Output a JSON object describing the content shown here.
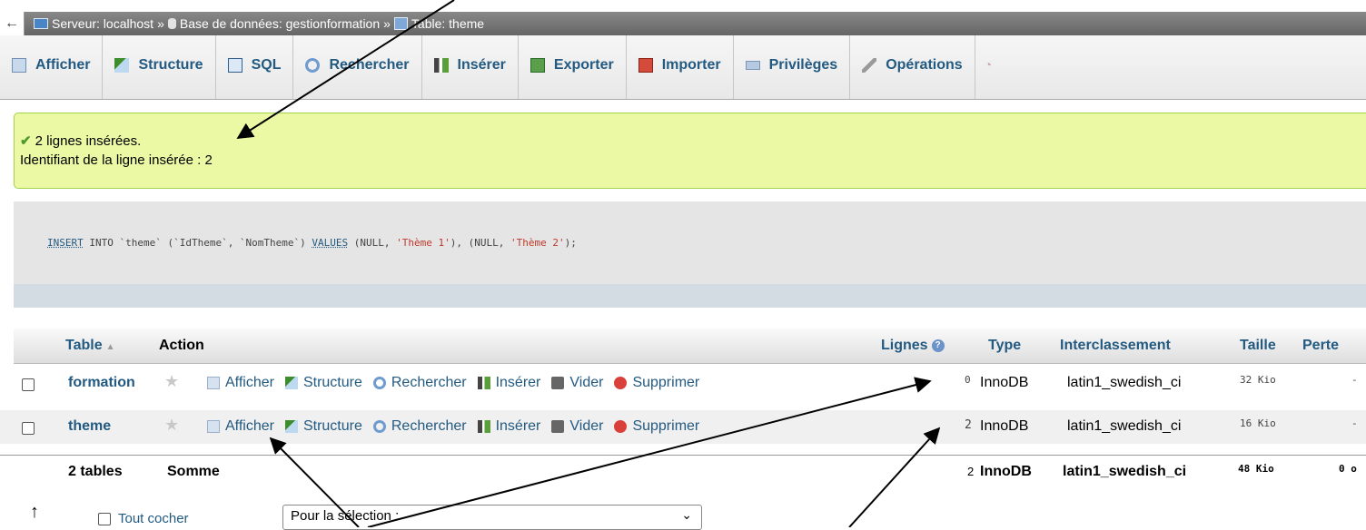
{
  "breadcrumb": {
    "back_icon": "←",
    "server": "Serveur: localhost",
    "database": "Base de données: gestionformation",
    "table": "Table: theme",
    "separator": "»"
  },
  "tabs": [
    {
      "label": "Afficher",
      "icon": "browse-icon"
    },
    {
      "label": "Structure",
      "icon": "structure-icon"
    },
    {
      "label": "SQL",
      "icon": "sql-icon"
    },
    {
      "label": "Rechercher",
      "icon": "search-icon"
    },
    {
      "label": "Insérer",
      "icon": "insert-icon"
    },
    {
      "label": "Exporter",
      "icon": "export-icon"
    },
    {
      "label": "Importer",
      "icon": "import-icon"
    },
    {
      "label": "Privilèges",
      "icon": "privileges-icon"
    },
    {
      "label": "Opérations",
      "icon": "operations-icon"
    }
  ],
  "message": {
    "line1": "2 lignes insérées.",
    "line2": "Identifiant de la ligne insérée : 2"
  },
  "sql": {
    "insert": "INSERT",
    "into_table": " INTO `theme` (`IdTheme`, `NomTheme`) ",
    "values": "VALUES",
    "open1": " (NULL, ",
    "val1": "'Thème 1'",
    "mid": "), (NULL, ",
    "val2": "'Thème 2'",
    "close": ");"
  },
  "table_list": {
    "headers": {
      "table": "Table",
      "action": "Action",
      "rows": "Lignes",
      "type": "Type",
      "collation": "Interclassement",
      "size": "Taille",
      "overhead": "Perte"
    },
    "rows": [
      {
        "name": "formation",
        "rows": "0",
        "type": "InnoDB",
        "collation": "latin1_swedish_ci",
        "size": "32 Kio",
        "overhead": "-"
      },
      {
        "name": "theme",
        "rows": "2",
        "type": "InnoDB",
        "collation": "latin1_swedish_ci",
        "size": "16 Kio",
        "overhead": "-"
      }
    ],
    "actions": {
      "browse": "Afficher",
      "structure": "Structure",
      "search": "Rechercher",
      "insert": "Insérer",
      "empty": "Vider",
      "drop": "Supprimer"
    },
    "total": {
      "label": "2 tables",
      "sum": "Somme",
      "rows": "2",
      "type": "InnoDB",
      "collation": "latin1_swedish_ci",
      "size": "48 Kio",
      "overhead": "0 o"
    }
  },
  "bottom": {
    "check_all": "Tout cocher",
    "with_selected": "Pour la sélection :"
  }
}
